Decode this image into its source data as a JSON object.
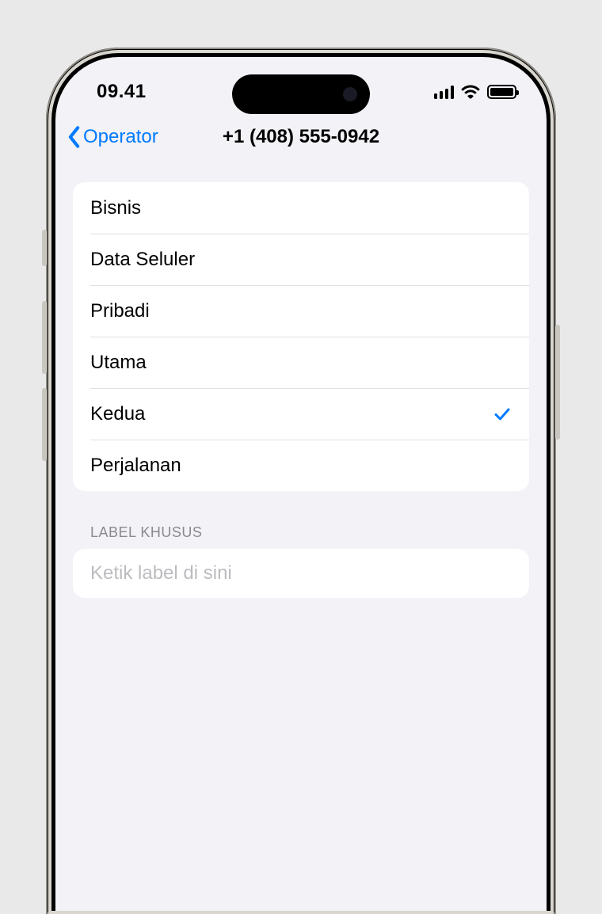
{
  "statusBar": {
    "time": "09.41"
  },
  "nav": {
    "backLabel": "Operator",
    "title": "+1 (408) 555-0942"
  },
  "labelOptions": [
    {
      "label": "Bisnis",
      "selected": false
    },
    {
      "label": "Data Seluler",
      "selected": false
    },
    {
      "label": "Pribadi",
      "selected": false
    },
    {
      "label": "Utama",
      "selected": false
    },
    {
      "label": "Kedua",
      "selected": true
    },
    {
      "label": "Perjalanan",
      "selected": false
    }
  ],
  "customLabel": {
    "header": "LABEL KHUSUS",
    "placeholder": "Ketik label di sini",
    "value": ""
  }
}
